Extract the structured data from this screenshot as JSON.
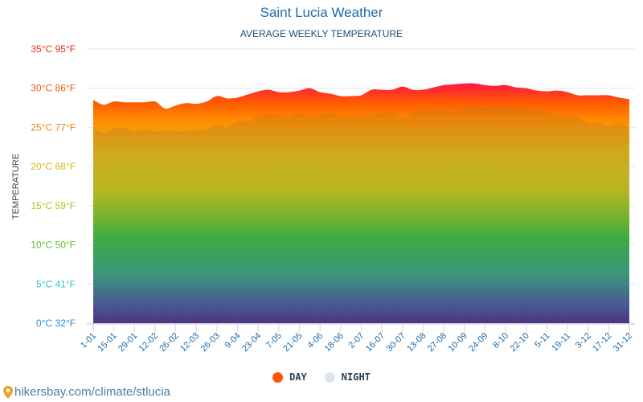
{
  "title": "Saint Lucia Weather",
  "subtitle": "AVERAGE WEEKLY TEMPERATURE",
  "footer": {
    "text": "hikersbay.com/climate/stlucia",
    "icon": "map-pin-icon"
  },
  "legend": [
    {
      "label": "DAY",
      "color": "#ff5500"
    },
    {
      "label": "NIGHT",
      "color": "#dde6ee"
    }
  ],
  "chart_data": {
    "type": "area",
    "title": "Saint Lucia Weather",
    "subtitle": "AVERAGE WEEKLY TEMPERATURE",
    "xlabel": "",
    "ylabel": "TEMPERATURE",
    "ylim": [
      0,
      35
    ],
    "yticks": [
      {
        "value": 0,
        "label": "0°C 32°F",
        "color": "#2a8fd6"
      },
      {
        "value": 5,
        "label": "5°C 41°F",
        "color": "#2ec4c4"
      },
      {
        "value": 10,
        "label": "10°C 50°F",
        "color": "#5cbf2a"
      },
      {
        "value": 15,
        "label": "15°C 59°F",
        "color": "#a8c41c"
      },
      {
        "value": 20,
        "label": "20°C 68°F",
        "color": "#d4b814"
      },
      {
        "value": 25,
        "label": "25°C 77°F",
        "color": "#f08018"
      },
      {
        "value": 30,
        "label": "30°C 86°F",
        "color": "#f05a14"
      },
      {
        "value": 35,
        "label": "35°C 95°F",
        "color": "#ee2a24"
      }
    ],
    "grid": true,
    "legend_position": "bottom-center",
    "x_tick_labels": [
      "1-01",
      "15-01",
      "29-01",
      "12-02",
      "26-02",
      "12-03",
      "26-03",
      "9-04",
      "23-04",
      "7-05",
      "21-05",
      "4-06",
      "18-06",
      "2-07",
      "16-07",
      "30-07",
      "13-08",
      "27-08",
      "10-09",
      "24-09",
      "8-10",
      "22-10",
      "5-11",
      "19-11",
      "3-12",
      "17-12",
      "31-12"
    ],
    "series": [
      {
        "name": "DAY",
        "values": [
          28.5,
          27.9,
          28.3,
          28.2,
          28.2,
          28.2,
          28.3,
          27.4,
          27.8,
          28.1,
          28.0,
          28.3,
          29.0,
          28.7,
          28.8,
          29.2,
          29.6,
          29.8,
          29.5,
          29.5,
          29.7,
          30.0,
          29.5,
          29.3,
          29.0,
          29.0,
          29.1,
          29.8,
          29.8,
          29.8,
          30.2,
          29.8,
          29.8,
          30.1,
          30.4,
          30.5,
          30.6,
          30.6,
          30.4,
          30.3,
          30.4,
          30.1,
          30.0,
          29.7,
          29.6,
          29.7,
          29.5,
          29.1,
          29.1,
          29.1,
          29.1,
          28.8,
          28.6
        ],
        "color": "#ff5500"
      },
      {
        "name": "NIGHT",
        "values": [
          24.8,
          24.3,
          24.9,
          24.9,
          24.5,
          24.7,
          24.5,
          24.6,
          24.5,
          24.5,
          24.6,
          24.7,
          25.3,
          25.0,
          25.8,
          25.8,
          26.4,
          26.7,
          26.6,
          26.2,
          26.8,
          26.5,
          26.6,
          26.8,
          26.4,
          26.6,
          26.5,
          26.6,
          26.8,
          26.9,
          26.2,
          26.9,
          27.2,
          27.3,
          27.3,
          27.0,
          27.5,
          27.6,
          27.5,
          27.6,
          27.7,
          27.5,
          27.4,
          27.2,
          27.0,
          26.5,
          26.6,
          26.3,
          25.5,
          25.6,
          25.1,
          25.6,
          24.8
        ],
        "color": "#dde6ee"
      }
    ]
  }
}
